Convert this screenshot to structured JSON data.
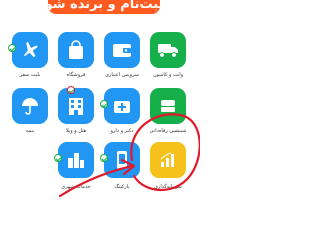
{
  "banner": {
    "text": "ثبت‌نام و برنده شو",
    "color": "#ff5a1f"
  },
  "services": [
    {
      "id": "car-inspection",
      "label": "وانت و کامیون",
      "icon": "truck-icon"
    },
    {
      "id": "installment",
      "label": "سرویس اعتباری",
      "icon": "wallet-icon"
    },
    {
      "id": "store",
      "label": "فروشگاه",
      "icon": "shopping-bag-icon"
    },
    {
      "id": "flight-ticket",
      "label": "بلیت سفر",
      "icon": "airplane-icon"
    },
    {
      "id": "welfare",
      "label": "شبنشین رفاه‌دانی",
      "icon": "food-icon"
    },
    {
      "id": "doctor",
      "label": "دکتر و دارو",
      "icon": "medical-icon"
    },
    {
      "id": "hotel",
      "label": "هتل و ویلا",
      "icon": "hotel-icon"
    },
    {
      "id": "insurance",
      "label": "بیمه",
      "icon": "umbrella-icon"
    },
    {
      "id": "investment",
      "label": "سرمایه‌گذاری",
      "icon": "chart-icon"
    },
    {
      "id": "charge",
      "label": "پارکینگ",
      "icon": "phone-icon"
    },
    {
      "id": "city-services",
      "label": "خدمات شهری",
      "icon": "city-icon"
    }
  ],
  "colors": {
    "tile_blue": "#2196f3",
    "tile_green": "#16b04a",
    "tile_yellow": "#f5c21b",
    "annotation_red": "#e0192b"
  }
}
